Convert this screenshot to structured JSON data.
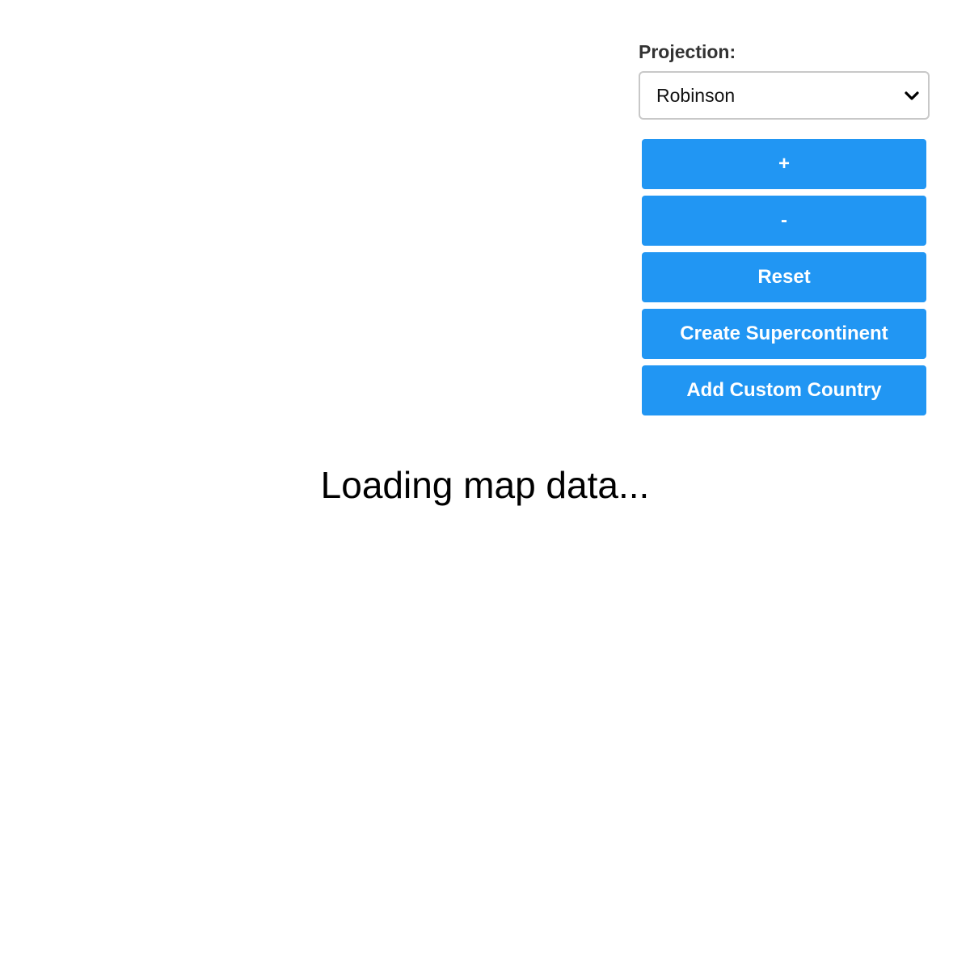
{
  "controls": {
    "projection_label": "Projection:",
    "projection_selected": "Robinson",
    "buttons": {
      "zoom_in": "+",
      "zoom_out": "-",
      "reset": "Reset",
      "create_supercontinent": "Create Supercontinent",
      "add_custom_country": "Add Custom Country"
    },
    "button_color": "#2196f3"
  },
  "status": {
    "loading_text": "Loading map data..."
  }
}
